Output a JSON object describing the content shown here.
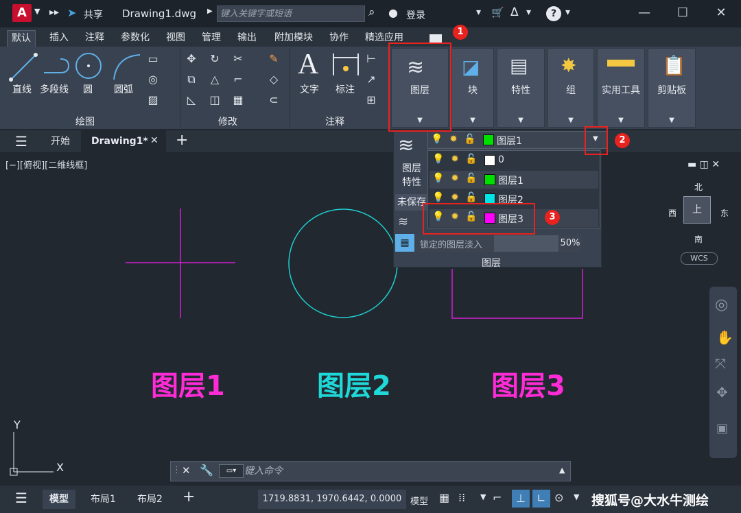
{
  "titlebar": {
    "logo": "A",
    "share_label": "共享",
    "file_name": "Drawing1.dwg",
    "search_placeholder": "键入关键字或短语",
    "login_label": "登录"
  },
  "ribbon_tabs": [
    "默认",
    "插入",
    "注释",
    "参数化",
    "视图",
    "管理",
    "输出",
    "附加模块",
    "协作",
    "精选应用"
  ],
  "ribbon": {
    "draw_tools": [
      "直线",
      "多段线",
      "圆",
      "圆弧"
    ],
    "draw_panel": "绘图",
    "modify_panel": "修改",
    "annot_tools": [
      "文字",
      "标注"
    ],
    "annot_panel": "注释",
    "big_tools": [
      "图层",
      "块",
      "特性",
      "组",
      "实用工具",
      "剪贴板"
    ]
  },
  "file_tabs": {
    "start": "开始",
    "drawing": "Drawing1*"
  },
  "view_label": "[−][俯视][二维线框]",
  "layer_panel": {
    "current": "图层1",
    "properties_label_1": "图层",
    "properties_label_2": "特性",
    "unsaved_label": "未保存",
    "fade_label": "锁定的图层淡入",
    "fade_value": "50%",
    "panel_title": "图层",
    "layers": [
      {
        "name": "0",
        "color": "#ffffff"
      },
      {
        "name": "图层1",
        "color": "#00e000"
      },
      {
        "name": "图层2",
        "color": "#00e5e5"
      },
      {
        "name": "图层3",
        "color": "#ff00ff"
      }
    ]
  },
  "canvas_labels": [
    {
      "text": "图层1",
      "color": "#ff2bd6"
    },
    {
      "text": "图层2",
      "color": "#1fd8d8"
    },
    {
      "text": "图层3",
      "color": "#ff2bd6"
    }
  ],
  "viewcube": {
    "north": "北",
    "south": "南",
    "west": "西",
    "east": "东",
    "face": "上",
    "wcs": "WCS"
  },
  "ucs": {
    "x": "X",
    "y": "Y"
  },
  "annotations": [
    "1",
    "2",
    "3"
  ],
  "command": {
    "placeholder": "键入命令"
  },
  "statusbar": {
    "tabs": [
      "模型",
      "布局1",
      "布局2"
    ],
    "coords": "1719.8831, 1970.6442, 0.0000",
    "model_label": "模型"
  },
  "watermark": "搜狐号@大水牛测绘"
}
